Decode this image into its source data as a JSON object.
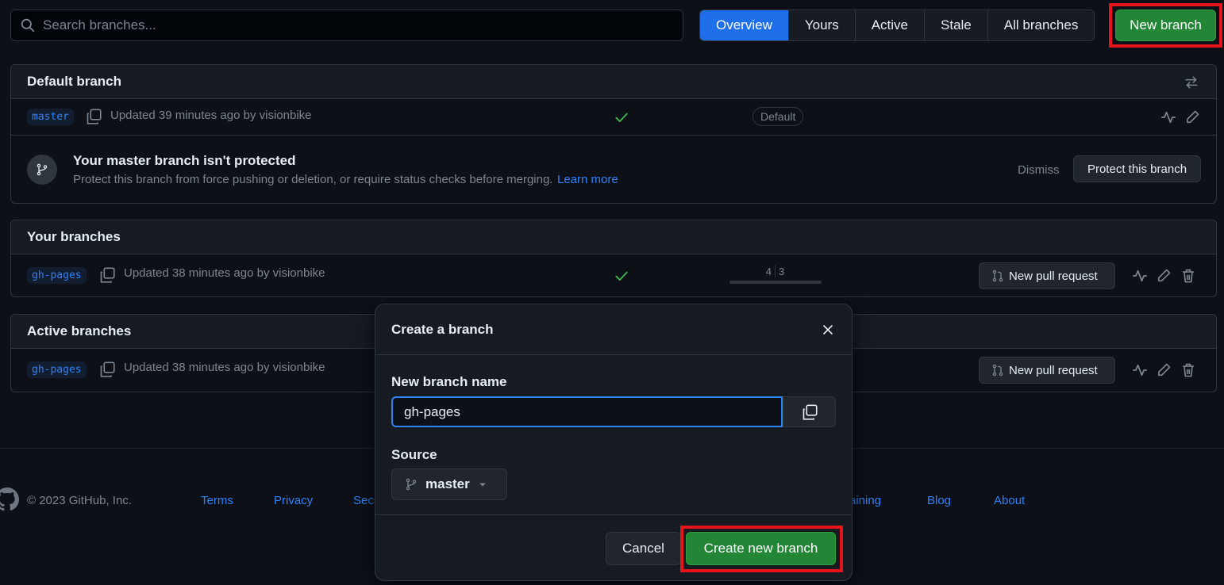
{
  "search": {
    "placeholder": "Search branches..."
  },
  "tabs": [
    {
      "label": "Overview",
      "selected": true
    },
    {
      "label": "Yours"
    },
    {
      "label": "Active"
    },
    {
      "label": "Stale"
    },
    {
      "label": "All branches"
    }
  ],
  "new_branch_label": "New branch",
  "default_section": {
    "title": "Default branch",
    "branch": {
      "name": "master",
      "updated": "Updated 39 minutes ago by visionbike",
      "badge": "Default"
    },
    "notice": {
      "title": "Your master branch isn't protected",
      "text": "Protect this branch from force pushing or deletion, or require status checks before merging.",
      "link": "Learn more",
      "dismiss": "Dismiss",
      "protect_label": "Protect this branch"
    }
  },
  "your_section": {
    "title": "Your branches",
    "branch": {
      "name": "gh-pages",
      "updated": "Updated 38 minutes ago by visionbike",
      "behind": "4",
      "ahead": "3",
      "pr_label": "New pull request"
    }
  },
  "active_section": {
    "title": "Active branches",
    "branch": {
      "name": "gh-pages",
      "updated": "Updated 38 minutes ago by visionbike",
      "pr_label": "New pull request"
    }
  },
  "footer": {
    "copyright": "© 2023 GitHub, Inc.",
    "links": [
      "Terms",
      "Privacy",
      "Secu",
      "aining",
      "Blog",
      "About"
    ]
  },
  "modal": {
    "title": "Create a branch",
    "name_label": "New branch name",
    "name_value": "gh-pages",
    "source_label": "Source",
    "source_value": "master",
    "cancel_label": "Cancel",
    "create_label": "Create new branch"
  },
  "colors": {
    "background": "#0d1117",
    "accent": "#1f6feb",
    "primary_button": "#238636",
    "highlight": "#e5141b",
    "link": "#2f81f7"
  }
}
